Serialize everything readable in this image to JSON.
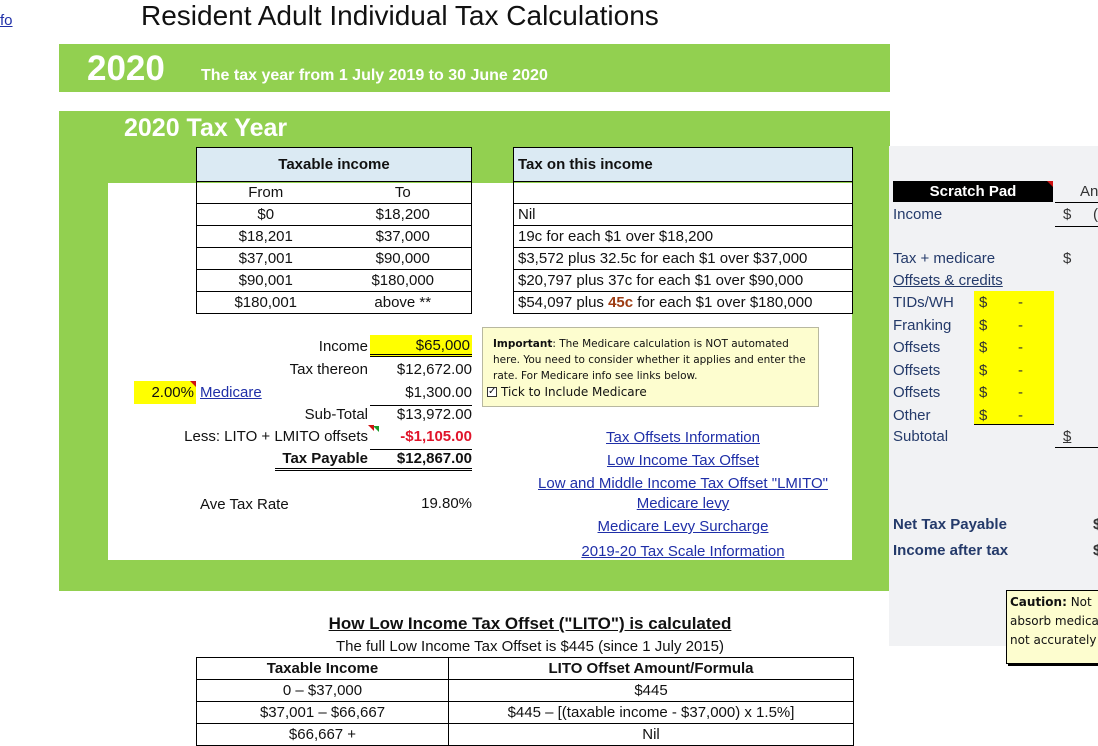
{
  "info_link": "fo",
  "page_title": "Resident Adult Individual Tax Calculations",
  "banner": {
    "year": "2020",
    "subtitle": "The tax year from 1 July 2019 to 30 June 2020"
  },
  "section_title": "2020 Tax Year",
  "taxable_income_table": {
    "header": "Taxable income",
    "col_from": "From",
    "col_to": "To",
    "rows": [
      {
        "from": "$0",
        "to": "$18,200"
      },
      {
        "from": "$18,201",
        "to": "$37,000"
      },
      {
        "from": "$37,001",
        "to": "$90,000"
      },
      {
        "from": "$90,001",
        "to": "$180,000"
      },
      {
        "from": "$180,001",
        "to": "above **"
      }
    ]
  },
  "tax_table": {
    "header": "Tax on this income",
    "rows": [
      "Nil",
      "19c for each $1 over $18,200",
      "$3,572 plus 32.5c for each $1 over $37,000",
      "$20,797 plus 37c for each $1 over $90,000"
    ],
    "last_row": {
      "prefix": "$54,097 plus ",
      "highlight": "45c",
      "suffix": " for each $1 over $180,000"
    }
  },
  "calculation": {
    "income_label": "Income",
    "income_value": "$65,000",
    "tax_thereon_label": "Tax thereon",
    "tax_thereon_value": "$12,672.00",
    "medicare_rate": "2.00%",
    "medicare_label": "Medicare",
    "medicare_value": "$1,300.00",
    "subtotal_label": "Sub-Total",
    "subtotal_value": "$13,972.00",
    "offsets_label": "Less: LITO + LMITO offsets",
    "offsets_value": "-$1,105.00",
    "tax_payable_label": "Tax Payable",
    "tax_payable_value": "$12,867.00",
    "ave_rate_label": "Ave Tax Rate",
    "ave_rate_value": "19.80%"
  },
  "note": {
    "bold": "Important",
    "text1": ": The Medicare calculation is  NOT automated here.  You need to consider whether it applies and enter the rate.  For Medicare info see links below.",
    "checkbox_label": "Tick to Include Medicare",
    "checkbox_checked": true
  },
  "links": [
    "Tax Offsets Information",
    "Low Income Tax Offset",
    "Low and Middle Income Tax Offset \"LMITO\"",
    "Medicare levy",
    "Medicare Levy Surcharge",
    "2019-20 Tax Scale Information"
  ],
  "scratch_pad": {
    "title": "Scratch Pad",
    "amount_header": "An",
    "income_label": "Income",
    "income_dollar": "$",
    "income_value_partial": "(",
    "tax_medicare_label": "Tax + medicare",
    "tax_medicare_dollar": "$",
    "offsets_credits_label": "Offsets & credits",
    "items": [
      {
        "label": "TIDs/WH",
        "dollar": "$",
        "value": "-"
      },
      {
        "label": "Franking",
        "dollar": "$",
        "value": "-"
      },
      {
        "label": "Offsets",
        "dollar": "$",
        "value": "-"
      },
      {
        "label": "Offsets",
        "dollar": "$",
        "value": "-"
      },
      {
        "label": "Offsets",
        "dollar": "$",
        "value": "-"
      },
      {
        "label": "Other",
        "dollar": "$",
        "value": "-"
      }
    ],
    "subtotal_label": "Subtotal",
    "subtotal_dollar": "$",
    "net_tax_label": "Net Tax Payable",
    "income_after_tax_label": "Income after tax",
    "net_tax_dollar": "$",
    "income_after_tax_dollar": "$",
    "caution_bold": "Caution:",
    "caution_line1": " Not",
    "caution_line2": "absorb medica",
    "caution_line3": "not accurately"
  },
  "lito": {
    "title": "How Low Income Tax Offset (\"LITO\") is calculated",
    "subtitle": "The full Low Income Tax Offset is $445 (since 1 July 2015)",
    "col1": "Taxable Income",
    "col2": "LITO Offset Amount/Formula",
    "rows": [
      {
        "income": "0 – $37,000",
        "formula": "$445"
      },
      {
        "income": "$37,001 – $66,667",
        "formula": "$445 – [(taxable income - $37,000) x 1.5%]"
      },
      {
        "income": "$66,667 +",
        "formula": "Nil"
      }
    ]
  },
  "colors": {
    "green": "#92d050",
    "yellow": "#ffff00",
    "link": "#1f2fa8",
    "negative": "#e0142a",
    "note_bg": "#fdfdcf"
  }
}
